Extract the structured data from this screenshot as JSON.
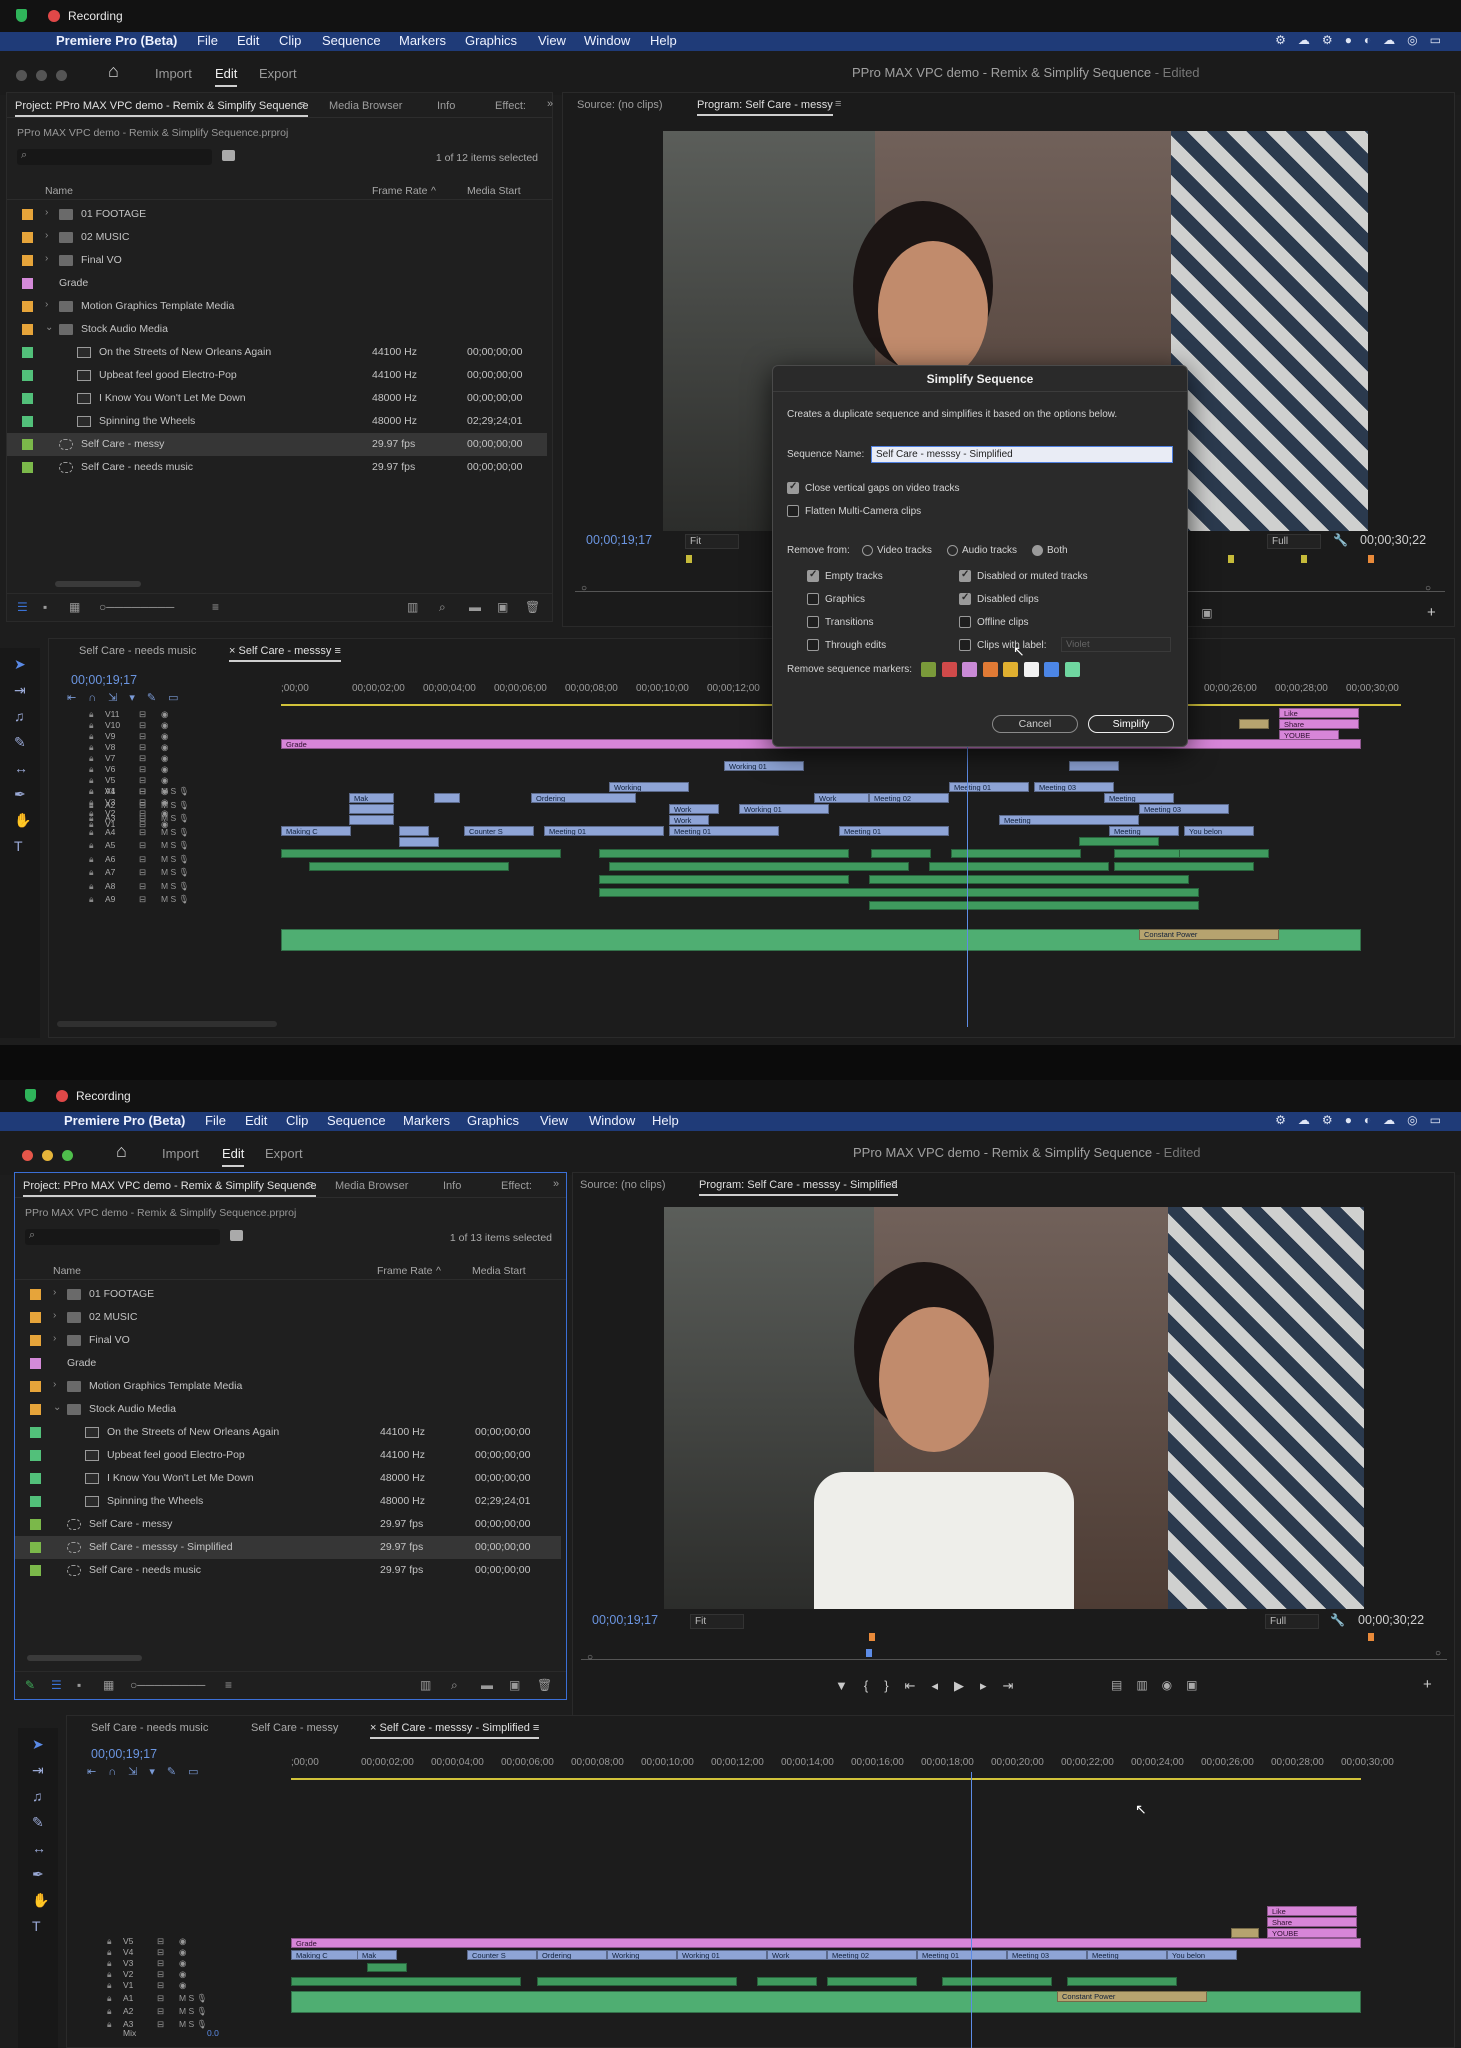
{
  "recorder": {
    "label": "Recording"
  },
  "menubar": {
    "app": "Premiere Pro (Beta)",
    "items": [
      "File",
      "Edit",
      "Clip",
      "Sequence",
      "Markers",
      "Graphics",
      "View",
      "Window",
      "Help"
    ]
  },
  "workspaces": [
    "Import",
    "Edit",
    "Export"
  ],
  "window_title": "PPro MAX VPC demo - Remix & Simplify Sequence",
  "window_title_status": "- Edited",
  "project": {
    "tab": "Project: PPro MAX VPC demo - Remix & Simplify Sequence",
    "other_tabs": [
      "Media Browser",
      "Info",
      "Effect:"
    ],
    "path": "PPro MAX VPC demo - Remix & Simplify Sequence.prproj",
    "columns": [
      "Name",
      "Frame Rate",
      "Media Start"
    ],
    "count_before": "1 of 12 items selected",
    "count_after": "1 of 13 items selected"
  },
  "items_before": [
    {
      "name": "01 FOOTAGE",
      "rate": "",
      "start": "",
      "color": "#e6a43a",
      "kind": "folder",
      "indent": 0,
      "twirl": ">"
    },
    {
      "name": "02 MUSIC",
      "rate": "",
      "start": "",
      "color": "#e6a43a",
      "kind": "folder",
      "indent": 0,
      "twirl": ">"
    },
    {
      "name": "Final VO",
      "rate": "",
      "start": "",
      "color": "#e6a43a",
      "kind": "folder",
      "indent": 0,
      "twirl": ">"
    },
    {
      "name": "Grade",
      "rate": "",
      "start": "",
      "color": "#d48ad9",
      "kind": "item",
      "indent": 0,
      "twirl": ""
    },
    {
      "name": "Motion Graphics Template Media",
      "rate": "",
      "start": "",
      "color": "#e6a43a",
      "kind": "folder",
      "indent": 0,
      "twirl": ">"
    },
    {
      "name": "Stock Audio Media",
      "rate": "",
      "start": "",
      "color": "#e6a43a",
      "kind": "folder",
      "indent": 0,
      "twirl": "v"
    },
    {
      "name": "On the Streets of New Orleans Again",
      "rate": "44100 Hz",
      "start": "00;00;00;00",
      "color": "#52c07a",
      "kind": "audio",
      "indent": 1,
      "twirl": ""
    },
    {
      "name": "Upbeat feel good Electro-Pop",
      "rate": "44100 Hz",
      "start": "00;00;00;00",
      "color": "#52c07a",
      "kind": "audio",
      "indent": 1,
      "twirl": ""
    },
    {
      "name": "I Know You Won't Let Me Down",
      "rate": "48000 Hz",
      "start": "00;00;00;00",
      "color": "#52c07a",
      "kind": "audio",
      "indent": 1,
      "twirl": ""
    },
    {
      "name": "Spinning the Wheels",
      "rate": "48000 Hz",
      "start": "02;29;24;01",
      "color": "#52c07a",
      "kind": "audio",
      "indent": 1,
      "twirl": ""
    },
    {
      "name": "Self Care - messy",
      "rate": "29.97 fps",
      "start": "00;00;00;00",
      "color": "#7bb84a",
      "kind": "seq",
      "indent": 0,
      "twirl": "",
      "sel": true
    },
    {
      "name": "Self Care - needs music",
      "rate": "29.97 fps",
      "start": "00;00;00;00",
      "color": "#7bb84a",
      "kind": "seq",
      "indent": 0,
      "twirl": ""
    }
  ],
  "items_after": [
    {
      "name": "01 FOOTAGE",
      "rate": "",
      "start": "",
      "color": "#e6a43a",
      "kind": "folder",
      "indent": 0,
      "twirl": ">"
    },
    {
      "name": "02 MUSIC",
      "rate": "",
      "start": "",
      "color": "#e6a43a",
      "kind": "folder",
      "indent": 0,
      "twirl": ">"
    },
    {
      "name": "Final VO",
      "rate": "",
      "start": "",
      "color": "#e6a43a",
      "kind": "folder",
      "indent": 0,
      "twirl": ">"
    },
    {
      "name": "Grade",
      "rate": "",
      "start": "",
      "color": "#d48ad9",
      "kind": "item",
      "indent": 0,
      "twirl": ""
    },
    {
      "name": "Motion Graphics Template Media",
      "rate": "",
      "start": "",
      "color": "#e6a43a",
      "kind": "folder",
      "indent": 0,
      "twirl": ">"
    },
    {
      "name": "Stock Audio Media",
      "rate": "",
      "start": "",
      "color": "#e6a43a",
      "kind": "folder",
      "indent": 0,
      "twirl": "v"
    },
    {
      "name": "On the Streets of New Orleans Again",
      "rate": "44100 Hz",
      "start": "00;00;00;00",
      "color": "#52c07a",
      "kind": "audio",
      "indent": 1,
      "twirl": ""
    },
    {
      "name": "Upbeat feel good Electro-Pop",
      "rate": "44100 Hz",
      "start": "00;00;00;00",
      "color": "#52c07a",
      "kind": "audio",
      "indent": 1,
      "twirl": ""
    },
    {
      "name": "I Know You Won't Let Me Down",
      "rate": "48000 Hz",
      "start": "00;00;00;00",
      "color": "#52c07a",
      "kind": "audio",
      "indent": 1,
      "twirl": ""
    },
    {
      "name": "Spinning the Wheels",
      "rate": "48000 Hz",
      "start": "02;29;24;01",
      "color": "#52c07a",
      "kind": "audio",
      "indent": 1,
      "twirl": ""
    },
    {
      "name": "Self Care - messy",
      "rate": "29.97 fps",
      "start": "00;00;00;00",
      "color": "#7bb84a",
      "kind": "seq",
      "indent": 0,
      "twirl": ""
    },
    {
      "name": "Self Care - messsy - Simplified",
      "rate": "29.97 fps",
      "start": "00;00;00;00",
      "color": "#7bb84a",
      "kind": "seq",
      "indent": 0,
      "twirl": "",
      "sel": true
    },
    {
      "name": "Self Care - needs music",
      "rate": "29.97 fps",
      "start": "00;00;00;00",
      "color": "#7bb84a",
      "kind": "seq",
      "indent": 0,
      "twirl": ""
    }
  ],
  "monitor": {
    "source_tab": "Source: (no clips)",
    "program_before": "Program: Self Care - messy",
    "program_after": "Program: Self Care - messsy - Simplified",
    "timecode": "00;00;19;17",
    "fit": "Fit",
    "quality": "Full",
    "duration": "00;00;30;22"
  },
  "timeline": {
    "tabs_before": [
      "Self Care - needs music",
      "Self Care - messsy"
    ],
    "tabs_after": [
      "Self Care - needs music",
      "Self Care - messy",
      "Self Care - messsy - Simplified"
    ],
    "timecode": "00;00;19;17",
    "ruler": [
      ";00;00",
      "00;00;02;00",
      "00;00;04;00",
      "00;00;06;00",
      "00;00;08;00",
      "00;00;10;00",
      "00;00;12;00",
      "00;00;14;00",
      "00;00;16;00",
      "00;00;18;00",
      "00;00;20;00",
      "00;00;22;00",
      "00;00;24;00",
      "00;00;26;00",
      "00;00;28;00",
      "00;00;30;00"
    ],
    "video_tracks_before": [
      "V11",
      "V10",
      "V9",
      "V8",
      "V7",
      "V6",
      "V5",
      "V4",
      "V3",
      "V2",
      "V1"
    ],
    "audio_tracks_before": [
      "A1",
      "A2",
      "A3",
      "A4",
      "A5",
      "A6",
      "A7",
      "A8",
      "A9"
    ],
    "video_tracks_after": [
      "V5",
      "V4",
      "V3",
      "V2",
      "V1"
    ],
    "audio_tracks_after": [
      "A1",
      "A2",
      "A3"
    ],
    "mix_label": "Mix",
    "mix_value": "0.0",
    "clip_labels": [
      "Grade",
      "Making C",
      "Mak",
      "Counter S",
      "Ordering",
      "Working",
      "Working 01",
      "Work",
      "Meeting 01",
      "Meeting 02",
      "Meeting 03",
      "Meeting",
      "You belon",
      "Like",
      "Share",
      "YOUBE",
      "Constant Power"
    ]
  },
  "dialog": {
    "title": "Simplify Sequence",
    "description": "Creates a duplicate sequence and simplifies it based on the options below.",
    "name_label": "Sequence Name:",
    "name_value": "Self Care - messsy - Simplified",
    "close_gaps": "Close vertical gaps on video tracks",
    "flatten": "Flatten Multi-Camera clips",
    "remove_from": "Remove from:",
    "radio_video": "Video tracks",
    "radio_audio": "Audio tracks",
    "radio_both": "Both",
    "empty_tracks": "Empty tracks",
    "graphics": "Graphics",
    "transitions": "Transitions",
    "through_edits": "Through edits",
    "disabled_tracks": "Disabled or muted tracks",
    "disabled_clips": "Disabled clips",
    "offline_clips": "Offline clips",
    "clips_with_label": "Clips with label:",
    "label_option": "Violet",
    "markers_label": "Remove sequence markers:",
    "marker_colors": [
      "#7a9a3a",
      "#d04a4a",
      "#c98ad6",
      "#e07a35",
      "#e0b030",
      "#f2f2f2",
      "#4c86e6",
      "#6fd6a0"
    ],
    "cancel": "Cancel",
    "simplify": "Simplify"
  }
}
